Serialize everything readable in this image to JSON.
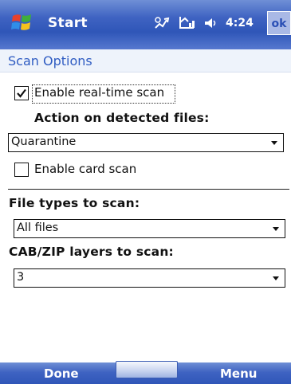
{
  "titlebar": {
    "title": "Start",
    "time": "4:24",
    "ok_label": "ok",
    "icons": [
      "windows-flag-icon",
      "connectivity-icon",
      "signal-icon",
      "volume-icon"
    ]
  },
  "page": {
    "title": "Scan Options"
  },
  "realtime": {
    "checkbox_label": "Enable real-time scan",
    "checked": true,
    "action_label": "Action on detected files:",
    "action_value": "Quarantine"
  },
  "card": {
    "checkbox_label": "Enable card scan",
    "checked": false
  },
  "filetypes": {
    "label": "File types to scan:",
    "value": "All files"
  },
  "layers": {
    "label": "CAB/ZIP layers to scan:",
    "value": "3"
  },
  "menubar": {
    "left_label": "Done",
    "right_label": "Menu"
  },
  "colors": {
    "titlebar": "#3f63c2",
    "page_title": "#2f5cc2"
  }
}
